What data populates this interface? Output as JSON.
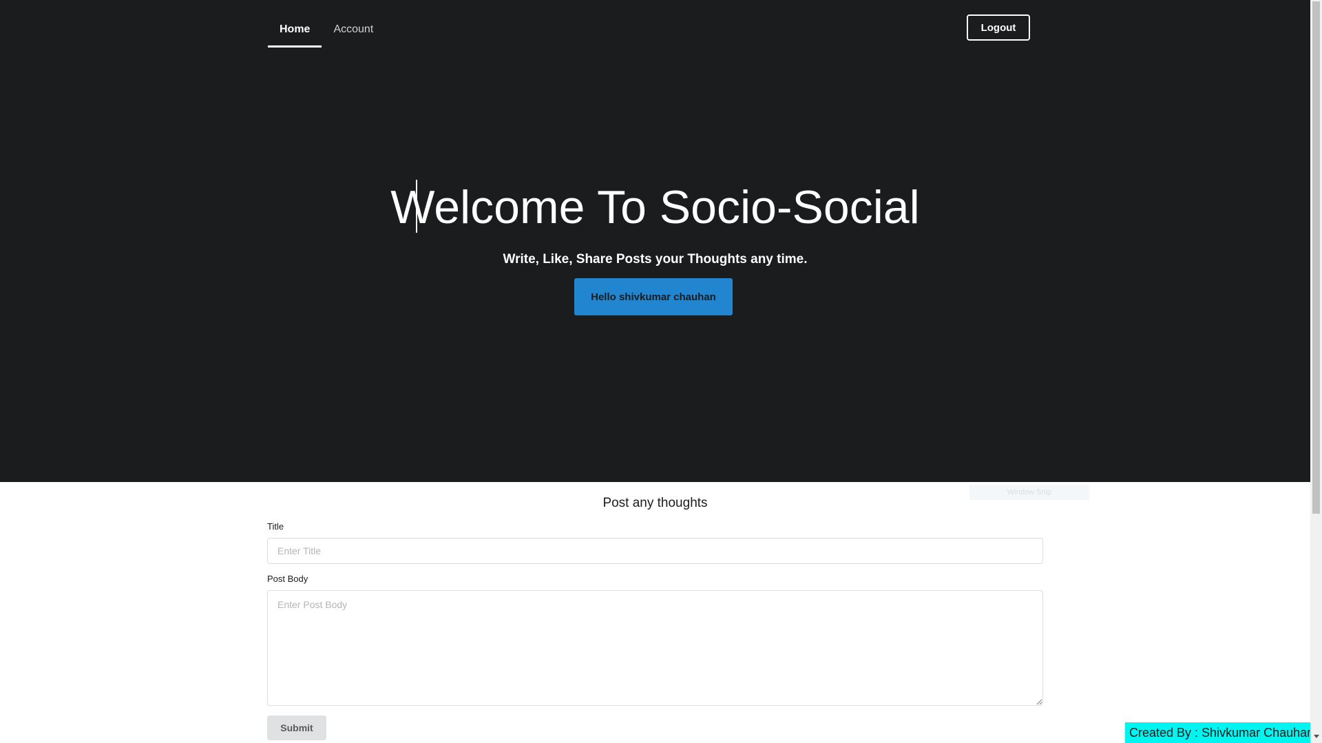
{
  "nav": {
    "items": [
      {
        "label": "Home",
        "active": true
      },
      {
        "label": "Account",
        "active": false
      }
    ],
    "logout_label": "Logout"
  },
  "hero": {
    "title": "Welcome To Socio-Social",
    "tagline": "Write, Like, Share Posts your Thoughts any time.",
    "greeting_button": "Hello shivkumar chauhan"
  },
  "post_form": {
    "heading": "Post any thoughts",
    "title_label": "Title",
    "title_placeholder": "Enter Title",
    "title_value": "",
    "body_label": "Post Body",
    "body_placeholder": "Enter Post Body",
    "body_value": "",
    "submit_label": "Submit"
  },
  "overlay": {
    "window_snip": "Window Snip"
  },
  "footer": {
    "credit": "Created By : Shivkumar Chauhan"
  },
  "colors": {
    "hero_bg": "#1b1c1d",
    "primary_button": "#2185d0",
    "credit_bg": "#00f5f0",
    "submit_bg": "#e0e1e2"
  }
}
